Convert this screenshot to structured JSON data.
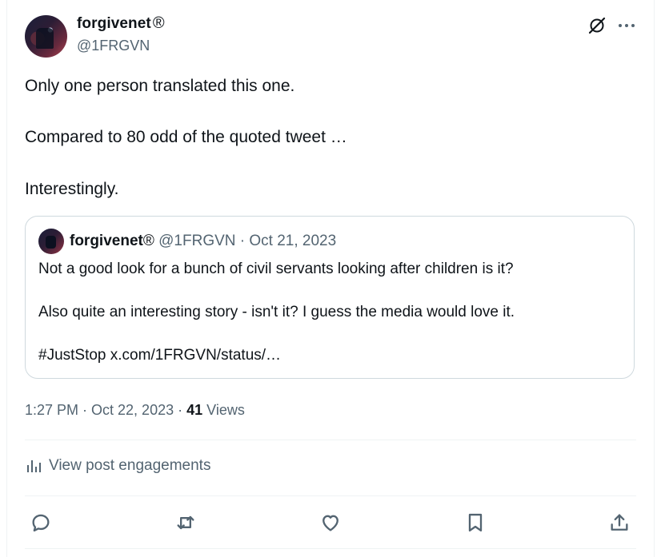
{
  "author": {
    "name": "forgivenet",
    "badge": "®",
    "handle": "@1FRGVN"
  },
  "post": {
    "lines": [
      "Only one person translated this one.",
      "Compared to 80 odd of the quoted tweet …",
      "Interestingly."
    ]
  },
  "quote": {
    "name": "forgivenet",
    "badge": "®",
    "meta": "@1FRGVN · Oct 21, 2023",
    "lines": [
      "Not a good look for a bunch of civil servants looking after children is it?",
      "Also quite an interesting story - isn't it? I guess the media would love it.",
      "#JustStop x.com/1FRGVN/status/…"
    ]
  },
  "meta": {
    "time_date": "1:27 PM · Oct 22, 2023 · ",
    "views_count": "41",
    "views_label": " Views"
  },
  "engagements": {
    "label": "View post engagements"
  },
  "icons": {
    "grok": "grok-icon",
    "more": "more-icon",
    "analytics": "bar-chart-icon",
    "reply": "reply-icon",
    "repost": "repost-icon",
    "like": "heart-icon",
    "bookmark": "bookmark-icon",
    "share": "share-icon"
  },
  "colors": {
    "text": "#0f1419",
    "secondary": "#536471",
    "border": "#cfd9de"
  }
}
